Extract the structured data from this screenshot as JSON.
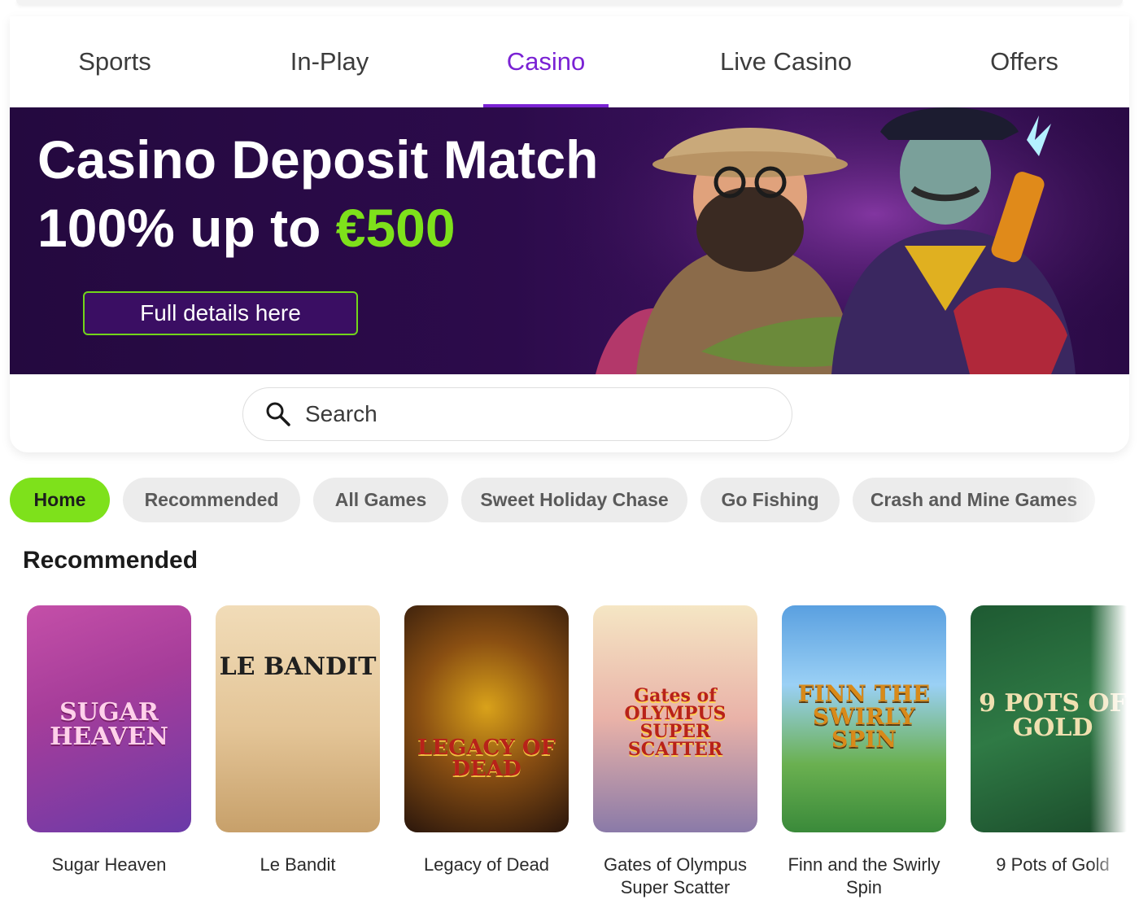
{
  "nav": {
    "tabs": [
      {
        "label": "Sports",
        "active": false
      },
      {
        "label": "In-Play",
        "active": false
      },
      {
        "label": "Casino",
        "active": true
      },
      {
        "label": "Live Casino",
        "active": false
      },
      {
        "label": "Offers",
        "active": false
      }
    ]
  },
  "banner": {
    "title_line1": "Casino Deposit Match",
    "title_line2_prefix": "100% up to ",
    "title_line2_amount": "€500",
    "button_label": "Full details here"
  },
  "search": {
    "placeholder": "Search",
    "icon": "search-icon"
  },
  "categories": [
    {
      "label": "Home",
      "active": true
    },
    {
      "label": "Recommended",
      "active": false
    },
    {
      "label": "All Games",
      "active": false
    },
    {
      "label": "Sweet Holiday Chase",
      "active": false
    },
    {
      "label": "Go Fishing",
      "active": false
    },
    {
      "label": "Crash and Mine Games",
      "active": false
    }
  ],
  "recommended": {
    "title": "Recommended",
    "games": [
      {
        "name": "Sugar Heaven",
        "logo": "SUGAR HEAVEN"
      },
      {
        "name": "Le Bandit",
        "logo": "LE BANDIT"
      },
      {
        "name": "Legacy of Dead",
        "logo": "LEGACY OF DEAD"
      },
      {
        "name": "Gates of Olympus Super Scatter",
        "logo": "Gates of OLYMPUS SUPER SCATTER"
      },
      {
        "name": "Finn and the Swirly Spin",
        "logo": "FINN THE SWIRLY SPIN"
      },
      {
        "name": "9 Pots of Gold",
        "logo": "9 POTS OF GOLD"
      }
    ]
  },
  "colors": {
    "accent_purple": "#7a22d4",
    "accent_green": "#7ee11b",
    "banner_bg": "#2c0b4b"
  }
}
